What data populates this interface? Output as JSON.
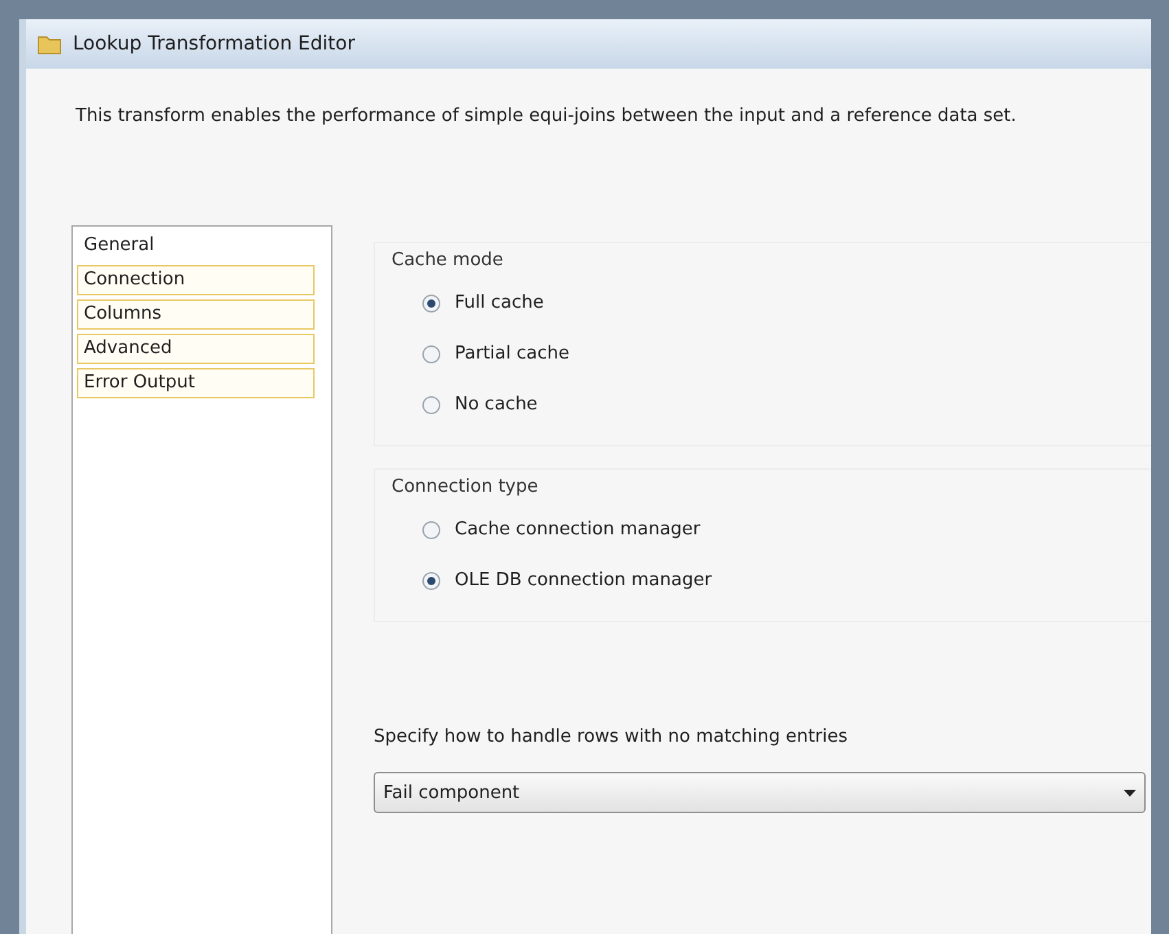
{
  "window": {
    "title": "Lookup Transformation Editor"
  },
  "description": "This transform enables the performance of simple equi-joins between the input and a reference data set.",
  "sidebar": {
    "items": [
      {
        "label": "General",
        "outlined": false
      },
      {
        "label": "Connection",
        "outlined": true
      },
      {
        "label": "Columns",
        "outlined": true
      },
      {
        "label": "Advanced",
        "outlined": true
      },
      {
        "label": "Error Output",
        "outlined": true
      }
    ]
  },
  "groups": [
    {
      "title": "Cache mode",
      "options": [
        {
          "label": "Full cache",
          "selected": true
        },
        {
          "label": "Partial cache",
          "selected": false
        },
        {
          "label": "No cache",
          "selected": false
        }
      ]
    },
    {
      "title": "Connection type",
      "options": [
        {
          "label": "Cache connection manager",
          "selected": false
        },
        {
          "label": "OLE DB connection manager",
          "selected": true
        }
      ]
    }
  ],
  "no_match": {
    "label": "Specify how to handle rows with no matching entries",
    "value": "Fail component"
  }
}
